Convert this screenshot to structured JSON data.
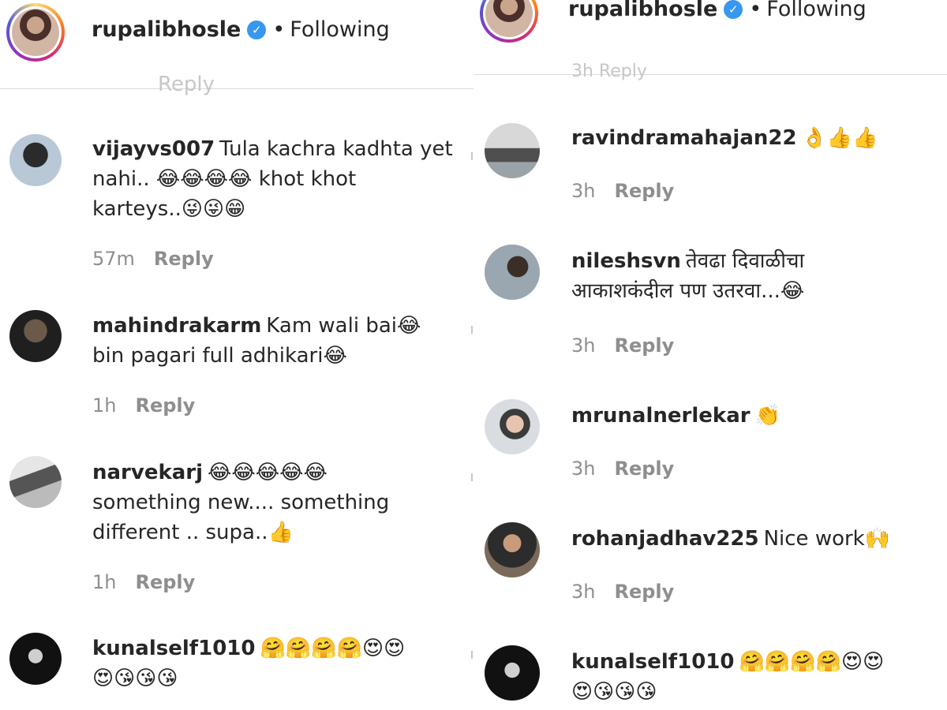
{
  "left": {
    "header": {
      "username": "rupalibhosle",
      "separator": "•",
      "follow": "Following"
    },
    "top_cutoff": "Reply",
    "comments": [
      {
        "username": "vijayvs007",
        "line1": "Tula kachra kadhta yet",
        "line2": "nahi.. 😂😂😂😂 khot khot",
        "line3": "karteys..😜😜😁",
        "time": "57m",
        "reply": "Reply"
      },
      {
        "username": "mahindrakarm",
        "line1": "Kam wali bai😂",
        "line2": "bin pagari full adhikari😂",
        "time": "1h",
        "reply": "Reply"
      },
      {
        "username": "narvekarj",
        "line1": "😂😂😂😂😂",
        "line2": "something new.... something",
        "line3": "different .. supa..👍",
        "time": "1h",
        "reply": "Reply"
      },
      {
        "username": "kunalself1010",
        "line1": "🤗🤗🤗🤗😍😍",
        "line2": "😍😘😘😘"
      }
    ]
  },
  "right": {
    "header": {
      "username": "rupalibhosle",
      "separator": "•",
      "follow": "Following"
    },
    "top_cutoff": "3h  Reply",
    "comments": [
      {
        "username": "ravindramahajan22",
        "line1": "👌👍👍",
        "time": "3h",
        "reply": "Reply"
      },
      {
        "username": "nileshsvn",
        "line1": "तेवढा दिवाळीचा",
        "line2": "आकाशकंदील पण उतरवा...😂",
        "time": "3h",
        "reply": "Reply"
      },
      {
        "username": "mrunalnerlekar",
        "line1": "👏",
        "time": "3h",
        "reply": "Reply"
      },
      {
        "username": "rohanjadhav225",
        "line1": "Nice work🙌",
        "time": "3h",
        "reply": "Reply"
      },
      {
        "username": "kunalself1010",
        "line1": "🤗🤗🤗🤗😍😍",
        "line2": "😍😘😘😘"
      }
    ]
  },
  "icons": {
    "verified": "verified-check-icon"
  },
  "colors": {
    "text": "#262626",
    "muted": "#8e8e8e",
    "verified": "#3897f0",
    "divider": "#dbdbdb"
  }
}
